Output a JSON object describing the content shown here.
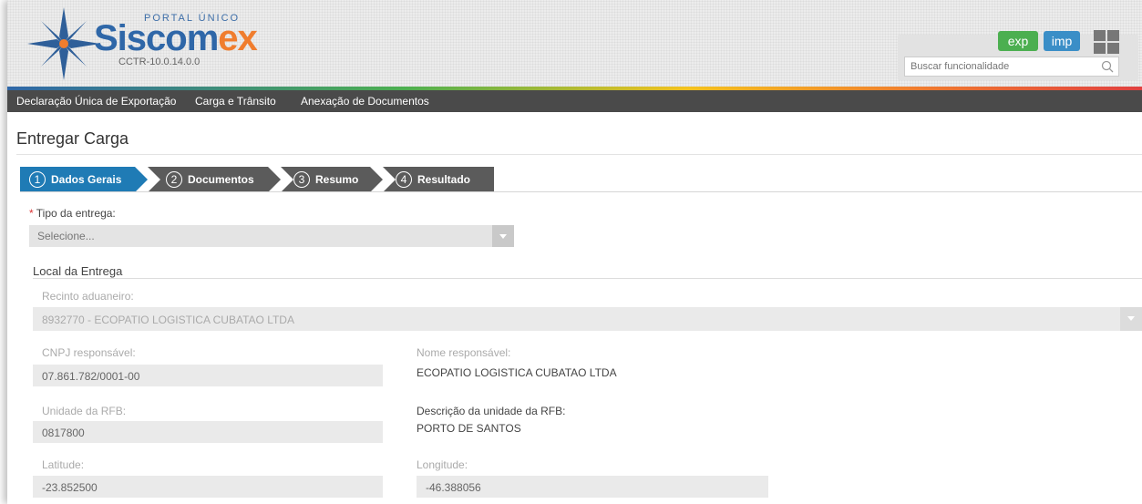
{
  "header": {
    "brand_small": "PORTAL ÚNICO",
    "brand_main_a": "Siscom",
    "brand_main_b": "ex",
    "version": "CCTR-10.0.14.0.0",
    "exp_label": "exp",
    "imp_label": "imp",
    "search_placeholder": "Buscar funcionalidade"
  },
  "nav": {
    "items": [
      "Declaração Única de Exportação",
      "Carga e Trânsito",
      "Anexação de Documentos"
    ]
  },
  "page": {
    "title": "Entregar Carga"
  },
  "steps": [
    {
      "num": "1",
      "label": "Dados Gerais",
      "active": true
    },
    {
      "num": "2",
      "label": "Documentos",
      "active": false
    },
    {
      "num": "3",
      "label": "Resumo",
      "active": false
    },
    {
      "num": "4",
      "label": "Resultado",
      "active": false
    }
  ],
  "form": {
    "required_mark": "*",
    "tipo_label": "Tipo da entrega:",
    "tipo_value": "Selecione...",
    "local_title": "Local da Entrega",
    "recinto_label": "Recinto aduaneiro:",
    "recinto_value": "8932770 - ECOPATIO LOGISTICA CUBATAO LTDA",
    "cnpj_label": "CNPJ responsável:",
    "cnpj_value": "07.861.782/0001-00",
    "nome_label": "Nome responsável:",
    "nome_value": "ECOPATIO LOGISTICA CUBATAO LTDA",
    "unidade_label": "Unidade da RFB:",
    "unidade_value": "0817800",
    "desc_label": "Descrição da unidade da RFB:",
    "desc_value": "PORTO DE SANTOS",
    "lat_label": "Latitude:",
    "lat_value": "-23.852500",
    "lon_label": "Longitude:",
    "lon_value": "-46.388056"
  },
  "colors": {
    "active_step": "#1f7bb5",
    "inactive_step": "#5b5b5b",
    "nav_bg": "#4a4a4a",
    "exp_button": "#4caf50",
    "imp_button": "#3a8ec7"
  },
  "icons": {
    "logo": "compass-star-logo",
    "apps": "apps-grid-icon",
    "search": "search-icon",
    "dropdown": "caret-down-icon"
  }
}
